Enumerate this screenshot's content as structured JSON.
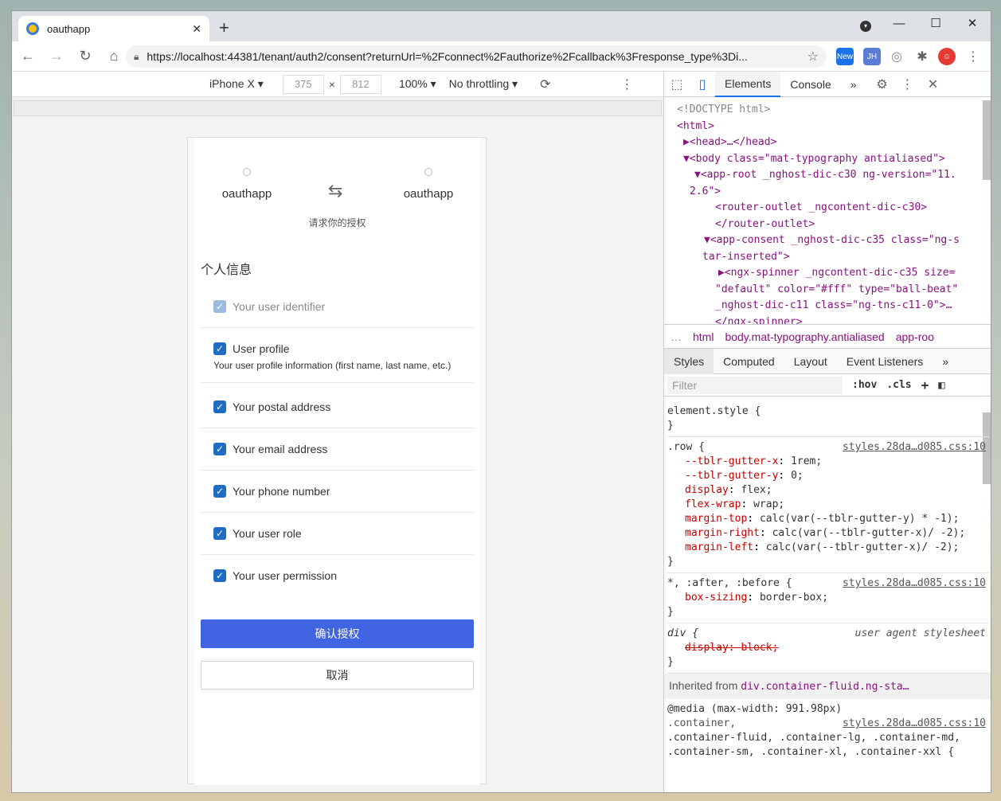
{
  "browser": {
    "tab_title": "oauthapp",
    "tab_close": "✕",
    "new_tab": "+",
    "url": "https://localhost:44381/tenant/auth2/consent?returnUrl=%2Fconnect%2Fauthorize%2Fcallback%3Fresponse_type%3Di...",
    "ext_new_label": "New",
    "ext_jh_label": "JH"
  },
  "device_toolbar": {
    "device": "iPhone X",
    "width": "375",
    "times": "×",
    "height": "812",
    "zoom": "100%",
    "throttling": "No throttling"
  },
  "consent": {
    "client_name": "oauthapp",
    "resource_name": "oauthapp",
    "subtitle": "请求你的授权",
    "section_title": "个人信息",
    "scopes": [
      {
        "label": "Your user identifier",
        "checked": true,
        "disabled": true
      },
      {
        "label": "User profile",
        "checked": true,
        "disabled": false,
        "description": "Your user profile information (first name, last name, etc.)"
      },
      {
        "label": "Your postal address",
        "checked": true,
        "disabled": false
      },
      {
        "label": "Your email address",
        "checked": true,
        "disabled": false
      },
      {
        "label": "Your phone number",
        "checked": true,
        "disabled": false
      },
      {
        "label": "Your user role",
        "checked": true,
        "disabled": false
      },
      {
        "label": "Your user permission",
        "checked": true,
        "disabled": false
      }
    ],
    "confirm_label": "确认授权",
    "cancel_label": "取消"
  },
  "devtools": {
    "tabs": [
      "Elements",
      "Console"
    ],
    "more": "»",
    "dom_lines": [
      "<!DOCTYPE html>",
      "<html>",
      "▶<head>…</head>",
      "▼<body class=\"mat-typography antialiased\">",
      "▼<app-root _nghost-dic-c30 ng-version=\"11.",
      "2.6\">",
      "<router-outlet _ngcontent-dic-c30>",
      "</router-outlet>",
      "▼<app-consent _nghost-dic-c35 class=\"ng-s",
      "tar-inserted\">",
      "▶<ngx-spinner _ngcontent-dic-c35 size=",
      "\"default\" color=\"#fff\" type=\"ball-beat\"",
      "_nghost-dic-c11 class=\"ng-tns-c11-0\">…",
      "</ngx-spinner>"
    ],
    "breadcrumb": [
      "…",
      "html",
      "body.mat-typography.antialiased",
      "app-roo"
    ],
    "style_tabs": [
      "Styles",
      "Computed",
      "Layout",
      "Event Listeners",
      "»"
    ],
    "filter_placeholder": "Filter",
    "hov": ":hov",
    "cls": ".cls",
    "add": "+",
    "rules": {
      "element_style": "element.style {",
      "close": "}",
      "row_selector": ".row {",
      "row_source": "styles.28da…d085.css:10",
      "row_props": [
        [
          "--tblr-gutter-x",
          "1rem;"
        ],
        [
          "--tblr-gutter-y",
          "0;"
        ],
        [
          "display",
          "flex;"
        ],
        [
          "flex-wrap",
          "wrap;"
        ],
        [
          "margin-top",
          "calc(var(--tblr-gutter-y) * -1);"
        ],
        [
          "margin-right",
          "calc(var(--tblr-gutter-x)/ -2);"
        ],
        [
          "margin-left",
          "calc(var(--tblr-gutter-x)/ -2);"
        ]
      ],
      "star_selector": "*, :after, :before {",
      "star_source": "styles.28da…d085.css:10",
      "star_prop": "box-sizing",
      "star_val": "border-box;",
      "div_selector": "div {",
      "div_source": "user agent stylesheet",
      "div_prop": "display: block;",
      "inherited_label": "Inherited from",
      "inherited_from": "div.container-fluid.ng-sta…",
      "media": "@media (max-width: 991.98px)",
      "media_selector": ".container,",
      "media_source": "styles.28da…d085.css:10",
      "media_rest": ".container-fluid, .container-lg, .container-md, .container-sm, .container-xl, .container-xxl {"
    }
  }
}
